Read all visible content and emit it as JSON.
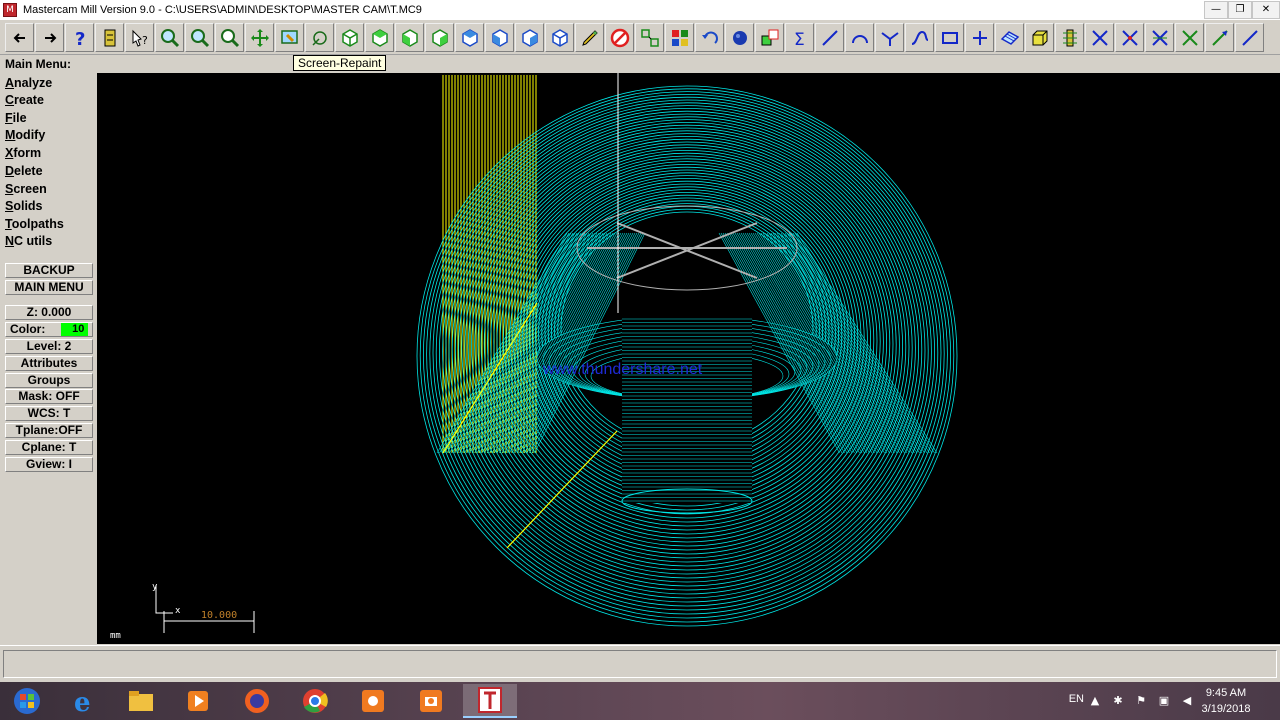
{
  "window": {
    "title": "Mastercam Mill Version 9.0 - C:\\USERS\\ADMIN\\DESKTOP\\MASTER CAM\\T.MC9",
    "minimize": "—",
    "maximize": "❐",
    "close": "✕"
  },
  "tooltip": "Screen-Repaint",
  "main_menu": {
    "title": "Main Menu:",
    "items": [
      {
        "hot": "A",
        "rest": "nalyze"
      },
      {
        "hot": "C",
        "rest": "reate"
      },
      {
        "hot": "F",
        "rest": "ile"
      },
      {
        "hot": "M",
        "rest": "odify"
      },
      {
        "hot": "X",
        "rest": "form"
      },
      {
        "hot": "D",
        "rest": "elete"
      },
      {
        "hot": "S",
        "rest": "creen"
      },
      {
        "hot": "S",
        "rest": "olids"
      },
      {
        "hot": "T",
        "rest": "oolpaths"
      },
      {
        "hot": "N",
        "rest": "C utils"
      }
    ],
    "backup": "BACKUP",
    "main_menu_btn": "MAIN MENU"
  },
  "settings": {
    "z": "Z:  0.000",
    "color_label": "Color:",
    "color_value": "10",
    "level": "Level:  2",
    "attributes": "Attributes",
    "groups": "Groups",
    "mask": "Mask:  OFF",
    "wcs": "WCS:   T",
    "tplane": "Tplane:OFF",
    "cplane": "Cplane:  T",
    "gview": "Gview:   I"
  },
  "viewport": {
    "watermark": "www.thundershare.net",
    "units": "mm",
    "scale_value": "10.000"
  },
  "taskbar": {
    "lang": "EN",
    "time": "9:45 AM",
    "date": "3/19/2018"
  },
  "colors": {
    "wire_cyan": "#00e6e6",
    "wire_yellow": "#ffff00",
    "viewport_bg": "#000000",
    "swatch_green": "#00ff00"
  }
}
